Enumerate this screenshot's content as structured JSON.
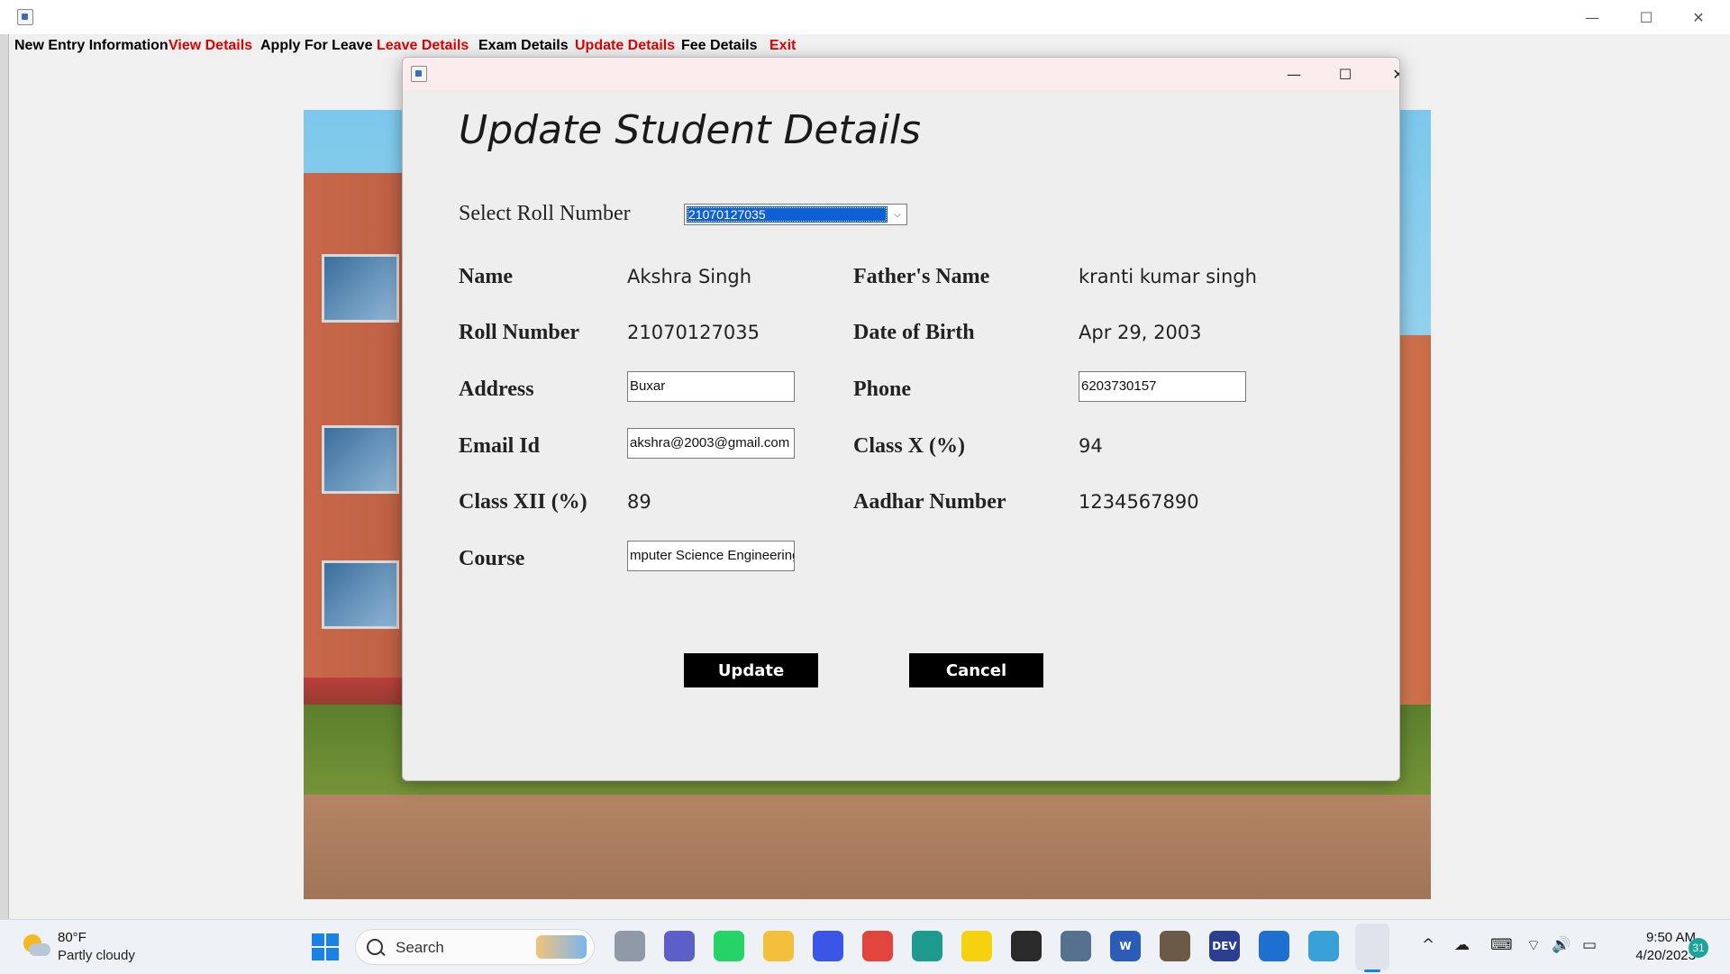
{
  "main_window": {
    "controls": {
      "minimize": "—",
      "maximize": "☐",
      "close": "✕"
    }
  },
  "menubar": {
    "items": [
      {
        "label": "New Entry Information",
        "color": "#000000"
      },
      {
        "label": "View Details",
        "color": "#e00000"
      },
      {
        "label": "Apply For Leave",
        "color": "#000000"
      },
      {
        "label": "Leave Details",
        "color": "#e00000"
      },
      {
        "label": "Exam Details",
        "color": "#000000"
      },
      {
        "label": "Update Details",
        "color": "#e00000"
      },
      {
        "label": "Fee Details",
        "color": "#000000"
      },
      {
        "label": "Exit",
        "color": "#e00000"
      }
    ]
  },
  "dialog": {
    "controls": {
      "minimize": "—",
      "maximize": "☐",
      "close": "✕"
    },
    "heading": "Update Student Details",
    "roll_select": {
      "label": "Select Roll Number",
      "selected": "21070127035",
      "arrow": "⌵"
    },
    "fields": {
      "name": {
        "label": "Name",
        "value": "Akshra Singh"
      },
      "father_name": {
        "label": "Father's Name",
        "value": "kranti kumar singh"
      },
      "roll_number": {
        "label": "Roll Number",
        "value": "21070127035"
      },
      "dob": {
        "label": "Date of Birth",
        "value": "Apr 29, 2003"
      },
      "address": {
        "label": "Address",
        "value": "Buxar"
      },
      "phone": {
        "label": "Phone",
        "value": "6203730157"
      },
      "email": {
        "label": "Email Id",
        "value": "akshra@2003@gmail.com"
      },
      "class_x": {
        "label": "Class X (%)",
        "value": "94"
      },
      "class_xii": {
        "label": "Class XII (%)",
        "value": "89"
      },
      "aadhar": {
        "label": "Aadhar Number",
        "value": "1234567890"
      },
      "course": {
        "label": "Course",
        "value": "mputer Science Engineering"
      }
    },
    "buttons": {
      "update": "Update",
      "cancel": "Cancel"
    }
  },
  "taskbar": {
    "weather": {
      "temp": "80°F",
      "desc": "Partly cloudy"
    },
    "search": {
      "placeholder": "Search"
    },
    "apps": [
      {
        "name": "task-view",
        "glyph": "",
        "color": "#8f9aa6"
      },
      {
        "name": "meet",
        "glyph": "",
        "color": "#5b5fc7"
      },
      {
        "name": "whatsapp",
        "glyph": "",
        "color": "#25d366"
      },
      {
        "name": "file-explorer",
        "glyph": "",
        "color": "#f2c03a"
      },
      {
        "name": "vs-app",
        "glyph": "",
        "color": "#3b55e6"
      },
      {
        "name": "chrome",
        "glyph": "",
        "color": "#e0443a"
      },
      {
        "name": "edge",
        "glyph": "",
        "color": "#1f9a8f"
      },
      {
        "name": "sticky-notes",
        "glyph": "",
        "color": "#f5d10f"
      },
      {
        "name": "media",
        "glyph": "",
        "color": "#2a2a2a"
      },
      {
        "name": "settings",
        "glyph": "",
        "color": "#55718f"
      },
      {
        "name": "word",
        "glyph": "W",
        "color": "#2b5cb8"
      },
      {
        "name": "tool",
        "glyph": "",
        "color": "#6b5a45"
      },
      {
        "name": "dev-cpp",
        "glyph": "DEV",
        "color": "#2c3e8f"
      },
      {
        "name": "app-n",
        "glyph": "",
        "color": "#1e6fd0"
      },
      {
        "name": "photos",
        "glyph": "",
        "color": "#3aa0d8"
      },
      {
        "name": "java",
        "glyph": "",
        "color": "#d44a2a"
      }
    ],
    "tray": {
      "chevron": "^",
      "cloud": "☁",
      "keyboard": "⌨",
      "wifi": "⌔",
      "volume": "🔊",
      "battery": "▭"
    },
    "clock": {
      "time": "9:50 AM",
      "date": "4/20/2023"
    },
    "notifications": "31"
  }
}
